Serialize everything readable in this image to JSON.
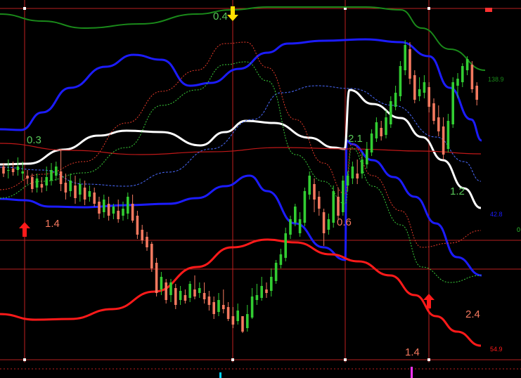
{
  "colors": {
    "background": "#000000",
    "up_candle": "#32cd32",
    "down_candle": "#f4795f",
    "upper_band": "#1c1cff",
    "lower_band": "#ff1a1a",
    "mid_line": "#ffffff",
    "outer_upper": "#1a8a1a",
    "markers": "#e02020",
    "grid_v": "#c02020",
    "arrow_up": "#ff1a1a",
    "arrow_down": "#ffe000",
    "label_green": "#58c858",
    "label_orange": "#f4795f"
  },
  "chart_data": {
    "type": "candlestick",
    "annotations": [
      {
        "text": "0.3",
        "color": "label_green"
      },
      {
        "text": "1.4",
        "color": "label_orange"
      },
      {
        "text": "0.4",
        "color": "label_green"
      },
      {
        "text": "2.1",
        "color": "label_green"
      },
      {
        "text": "0.6",
        "color": "label_orange"
      },
      {
        "text": "1.2",
        "color": "label_green"
      },
      {
        "text": "2.4",
        "color": "label_orange"
      },
      {
        "text": "1.4",
        "color": "label_orange"
      }
    ],
    "right_labels": [
      {
        "text": "138.9",
        "color": "outer_upper"
      },
      {
        "text": "42.8",
        "color": "upper_band"
      },
      {
        "text": "54.9",
        "color": "lower_band"
      },
      {
        "text": "0",
        "color": "up_candle"
      }
    ],
    "candles": [
      [
        275,
        265,
        260,
        280
      ],
      [
        270,
        270,
        258,
        285
      ],
      [
        272,
        267,
        262,
        282
      ],
      [
        270,
        275,
        262,
        288
      ],
      [
        265,
        268,
        255,
        282
      ],
      [
        262,
        258,
        250,
        270
      ],
      [
        260,
        243,
        238,
        265
      ],
      [
        245,
        258,
        238,
        265
      ],
      [
        250,
        245,
        238,
        260
      ],
      [
        248,
        260,
        240,
        275
      ],
      [
        255,
        270,
        248,
        280
      ],
      [
        262,
        275,
        255,
        282
      ],
      [
        268,
        250,
        240,
        300
      ],
      [
        252,
        238,
        228,
        265
      ],
      [
        240,
        255,
        232,
        265
      ],
      [
        248,
        230,
        222,
        262
      ],
      [
        235,
        250,
        225,
        258
      ],
      [
        245,
        228,
        220,
        255
      ],
      [
        232,
        240,
        225,
        248
      ],
      [
        238,
        222,
        218,
        245
      ],
      [
        225,
        208,
        200,
        232
      ],
      [
        210,
        228,
        202,
        235
      ],
      [
        222,
        205,
        198,
        232
      ],
      [
        208,
        218,
        200,
        222
      ],
      [
        212,
        200,
        195,
        228
      ],
      [
        205,
        215,
        198,
        225
      ],
      [
        208,
        232,
        200,
        238
      ],
      [
        222,
        198,
        195,
        235
      ],
      [
        205,
        178,
        172,
        212
      ],
      [
        185,
        170,
        165,
        192
      ],
      [
        175,
        160,
        155,
        182
      ],
      [
        165,
        130,
        125,
        168
      ],
      [
        138,
        95,
        90,
        145
      ],
      [
        100,
        118,
        92,
        125
      ],
      [
        110,
        85,
        80,
        115
      ],
      [
        92,
        110,
        82,
        115
      ],
      [
        102,
        78,
        72,
        108
      ],
      [
        85,
        98,
        78,
        105
      ],
      [
        92,
        84,
        80,
        100
      ],
      [
        88,
        108,
        82,
        112
      ],
      [
        100,
        90,
        86,
        120
      ],
      [
        95,
        102,
        88,
        110
      ],
      [
        95,
        86,
        80,
        110
      ],
      [
        90,
        78,
        70,
        98
      ],
      [
        82,
        65,
        58,
        90
      ],
      [
        68,
        85,
        62,
        95
      ],
      [
        78,
        72,
        66,
        100
      ],
      [
        75,
        58,
        55,
        82
      ],
      [
        62,
        50,
        45,
        75
      ],
      [
        55,
        70,
        50,
        80
      ],
      [
        62,
        40,
        38,
        62
      ],
      [
        45,
        65,
        40,
        78
      ],
      [
        60,
        90,
        58,
        102
      ],
      [
        85,
        92,
        78,
        108
      ],
      [
        88,
        105,
        84,
        118
      ],
      [
        100,
        95,
        88,
        110
      ],
      [
        98,
        118,
        90,
        130
      ],
      [
        112,
        138,
        108,
        142
      ],
      [
        135,
        150,
        130,
        158
      ],
      [
        145,
        180,
        140,
        188
      ],
      [
        178,
        200,
        172,
        205
      ],
      [
        195,
        218,
        190,
        222
      ],
      [
        180,
        200,
        175,
        210
      ],
      [
        195,
        240,
        190,
        245
      ],
      [
        235,
        262,
        228,
        268
      ],
      [
        250,
        228,
        210,
        258
      ],
      [
        232,
        215,
        205,
        240
      ],
      [
        210,
        180,
        162,
        215
      ],
      [
        185,
        200,
        178,
        208
      ],
      [
        195,
        240,
        188,
        248
      ],
      [
        232,
        205,
        200,
        245
      ],
      [
        210,
        255,
        205,
        262
      ],
      [
        248,
        262,
        240,
        268
      ],
      [
        258,
        275,
        250,
        282
      ],
      [
        265,
        258,
        250,
        285
      ],
      [
        265,
        285,
        258,
        295
      ],
      [
        278,
        300,
        272,
        310
      ],
      [
        295,
        322,
        290,
        328
      ],
      [
        315,
        338,
        310,
        345
      ],
      [
        330,
        318,
        312,
        340
      ],
      [
        320,
        345,
        315,
        355
      ],
      [
        335,
        368,
        330,
        375
      ],
      [
        360,
        380,
        355,
        390
      ],
      [
        375,
        418,
        368,
        425
      ],
      [
        412,
        448,
        405,
        455
      ],
      [
        442,
        400,
        392,
        452
      ],
      [
        405,
        370,
        365,
        412
      ],
      [
        375,
        385,
        368,
        402
      ],
      [
        380,
        395,
        372,
        405
      ],
      [
        388,
        360,
        352,
        395
      ],
      [
        365,
        340,
        335,
        372
      ],
      [
        345,
        325,
        318,
        362
      ],
      [
        332,
        292,
        285,
        345
      ],
      [
        300,
        340,
        295,
        350
      ],
      [
        335,
        395,
        330,
        402
      ],
      [
        390,
        400,
        372,
        408
      ],
      [
        395,
        418,
        388,
        422
      ],
      [
        412,
        428,
        405,
        432
      ],
      [
        420,
        385,
        380,
        425
      ],
      [
        390,
        370,
        362,
        395
      ]
    ],
    "series": [
      {
        "values": [
          184,
          184,
          184,
          183,
          182,
          181,
          180,
          178,
          176,
          172,
          168,
          164,
          160,
          156,
          150,
          144,
          138,
          132,
          127,
          122,
          118,
          114,
          111,
          108,
          105,
          103,
          101,
          99,
          97,
          96,
          95,
          94,
          93,
          92,
          92,
          92,
          91,
          90,
          90,
          90,
          90,
          90,
          88,
          88,
          88,
          87,
          86,
          86,
          85,
          84,
          83,
          82,
          80,
          78,
          77,
          76,
          75,
          74,
          75,
          74,
          76,
          75,
          76,
          77,
          78,
          79,
          80,
          81,
          83,
          84,
          86,
          87,
          88,
          89,
          90,
          90,
          91,
          92,
          93,
          94,
          96,
          98,
          100,
          102,
          104,
          107,
          110,
          114,
          118,
          122,
          127,
          133,
          140,
          148,
          156,
          164,
          172,
          180,
          188,
          198
        ]
      },
      {
        "values": [
          296,
          294,
          292,
          290,
          288,
          287,
          286,
          286,
          287,
          288,
          289,
          290,
          291,
          292,
          292,
          293,
          293,
          292,
          290,
          290,
          290,
          290,
          288,
          288,
          288,
          289,
          290,
          291,
          292,
          292,
          293,
          292,
          290,
          288,
          287,
          286,
          284,
          281,
          278,
          274,
          270,
          266,
          262,
          258,
          255,
          252,
          250,
          248,
          252,
          256,
          262,
          268,
          276,
          284,
          292,
          302,
          312,
          322,
          330,
          338,
          343,
          348,
          352,
          355,
          358,
          362,
          365,
          368,
          372,
          375,
          378,
          400,
          375,
          370,
          358,
          345,
          330,
          315,
          300,
          285,
          270,
          256,
          244,
          232,
          322,
          280,
          266,
          258,
          252,
          250,
          250,
          250,
          250,
          250,
          250,
          250,
          250,
          250,
          250,
          250
        ]
      }
    ]
  }
}
